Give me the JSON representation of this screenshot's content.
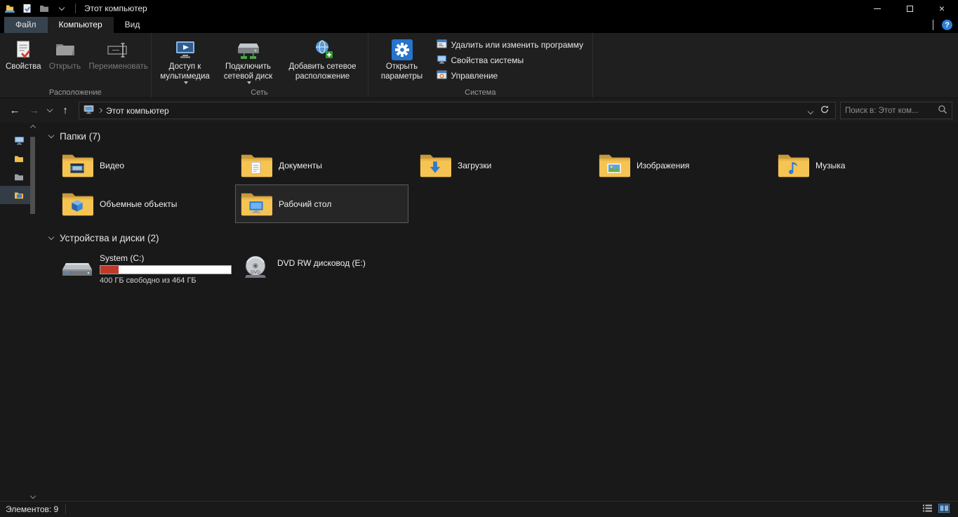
{
  "titlebar": {
    "title": "Этот компьютер"
  },
  "tabs": {
    "file": "Файл",
    "computer": "Компьютер",
    "view": "Вид"
  },
  "ribbon": {
    "location_group": {
      "label": "Расположение",
      "properties": "Свойства",
      "open": "Открыть",
      "rename": "Переименовать"
    },
    "network_group": {
      "label": "Сеть",
      "media_access": "Доступ к мультимедиа",
      "map_drive": "Подключить сетевой диск",
      "add_location": "Добавить сетевое расположение"
    },
    "system_group": {
      "label": "Система",
      "open_settings": "Открыть параметры",
      "uninstall": "Удалить или изменить программу",
      "system_properties": "Свойства системы",
      "manage": "Управление"
    }
  },
  "navbar": {
    "address": "Этот компьютер",
    "search_placeholder": "Поиск в: Этот ком..."
  },
  "content": {
    "folders_header": "Папки (7)",
    "folders": [
      {
        "label": "Видео",
        "glyph": "video"
      },
      {
        "label": "Документы",
        "glyph": "document"
      },
      {
        "label": "Загрузки",
        "glyph": "download"
      },
      {
        "label": "Изображения",
        "glyph": "picture"
      },
      {
        "label": "Музыка",
        "glyph": "music"
      },
      {
        "label": "Объемные объекты",
        "glyph": "cube"
      },
      {
        "label": "Рабочий стол",
        "glyph": "desktop",
        "selected": true
      }
    ],
    "devices_header": "Устройства и диски (2)",
    "drives": [
      {
        "label": "System (C:)",
        "caption": "400 ГБ свободно из 464 ГБ",
        "used_percent": 14,
        "type": "hdd"
      },
      {
        "label": "DVD RW дисковод (E:)",
        "type": "dvd",
        "icon_text": "DVD"
      }
    ]
  },
  "statusbar": {
    "items": "Элементов: 9"
  },
  "icons": {
    "back": "←",
    "forward": "→",
    "up": "↑",
    "close": "×",
    "help": "?"
  },
  "colors": {
    "accent": "#2b7cd3",
    "capacity_bar_fill": "#c0392b"
  }
}
